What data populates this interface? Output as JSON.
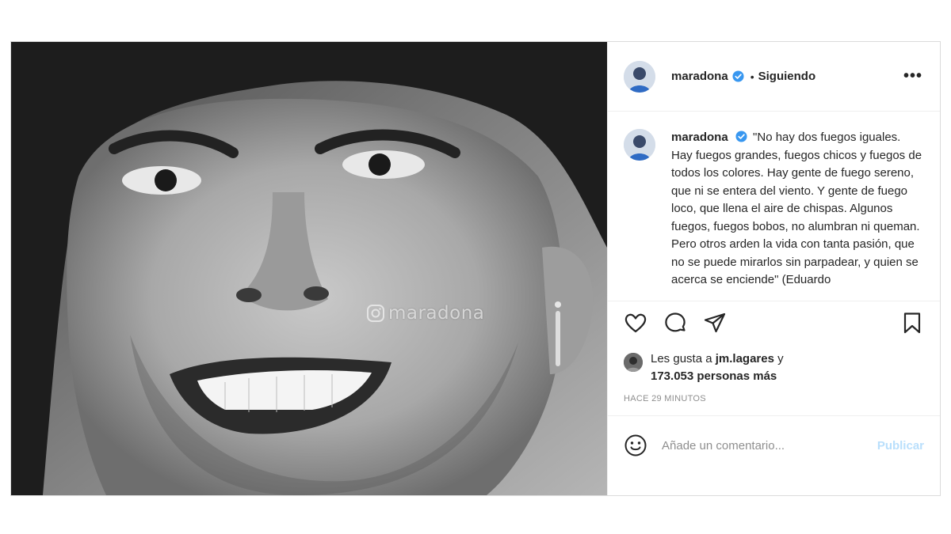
{
  "post": {
    "watermark": "maradona",
    "header": {
      "username": "maradona",
      "separator": "•",
      "follow_status": "Siguiendo",
      "more_label": "•••"
    },
    "caption": {
      "username": "maradona",
      "text": "\"No hay dos fuegos iguales. Hay fuegos grandes, fuegos chicos y fuegos de todos los colores. Hay gente de fuego sereno, que ni se entera del viento. Y gente de fuego loco, que llena el aire de chispas. Algunos fuegos, fuegos bobos, no alumbran ni queman. Pero otros arden la vida con tanta pasión, que no se puede mirarlos sin parpadear, y quien se acerca se enciende\" (Eduardo"
    },
    "actions": {
      "like_icon": "heart-icon",
      "comment_icon": "comment-icon",
      "share_icon": "paper-plane-icon",
      "save_icon": "bookmark-icon"
    },
    "likes": {
      "prefix": "Les gusta a ",
      "user": "jm.lagares",
      "conjunction": " y",
      "count_text": "173.053 personas más"
    },
    "timestamp": "HACE 29 MINUTOS",
    "comment": {
      "placeholder": "Añade un comentario...",
      "publish_label": "Publicar"
    },
    "colors": {
      "verified": "#3897f0",
      "publish_disabled": "#b9dffc",
      "text": "#262626",
      "muted": "#8e8e8e"
    }
  }
}
